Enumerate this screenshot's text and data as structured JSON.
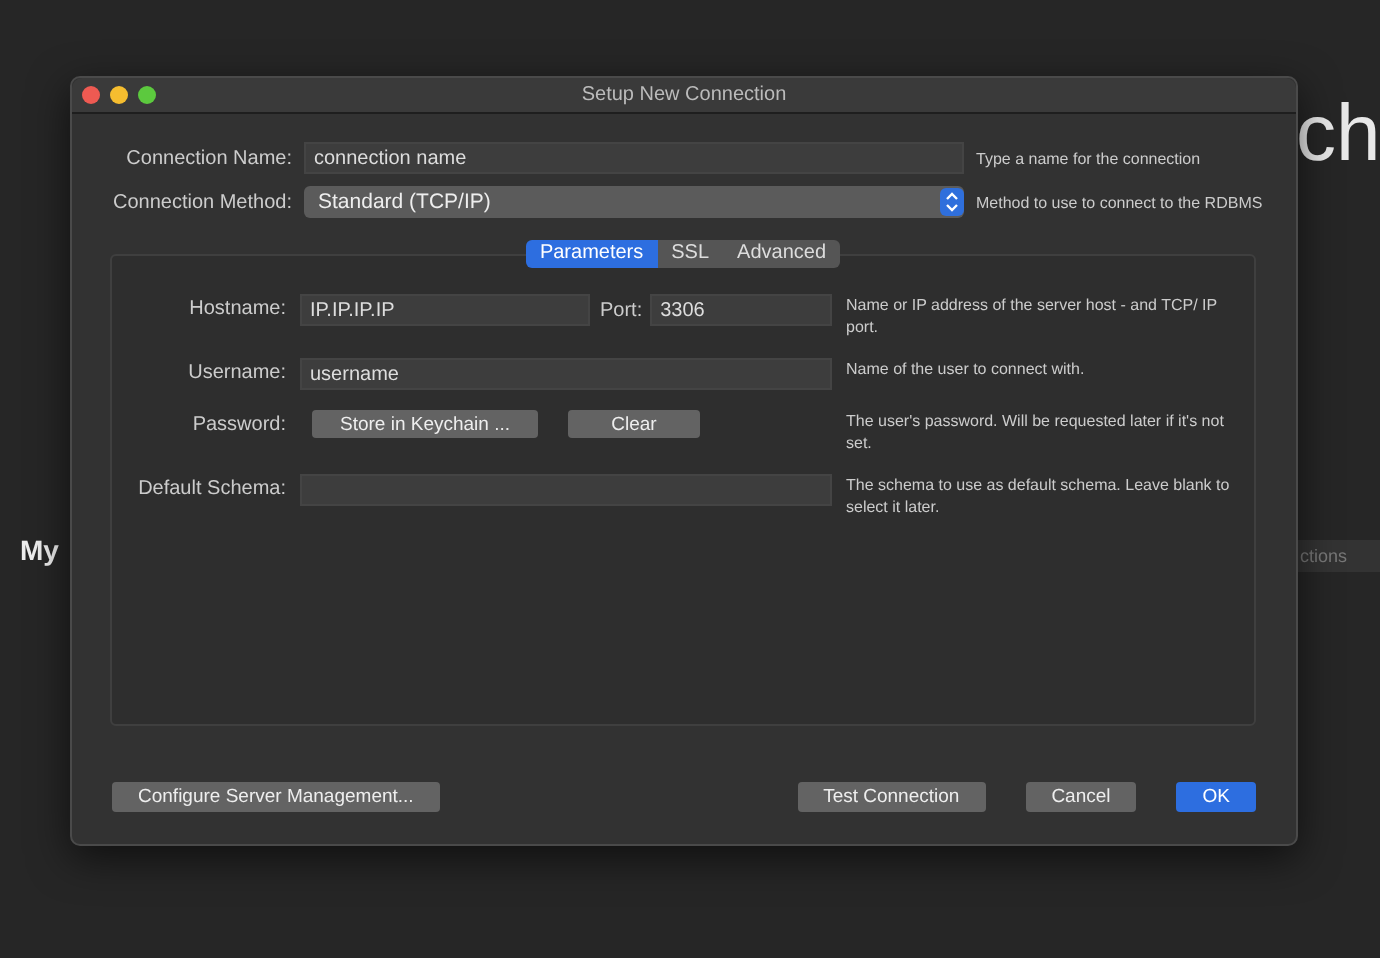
{
  "background": {
    "heading_right": "ch",
    "section_label": "My",
    "search": {
      "placeholder": "ctions"
    }
  },
  "window": {
    "title": "Setup New Connection"
  },
  "connection_name": {
    "label": "Connection Name:",
    "value": "connection name",
    "hint": "Type a name for the connection"
  },
  "connection_method": {
    "label": "Connection Method:",
    "value": "Standard (TCP/IP)",
    "hint": "Method to use to connect to the RDBMS"
  },
  "tabs": [
    {
      "label": "Parameters",
      "selected": true
    },
    {
      "label": "SSL",
      "selected": false
    },
    {
      "label": "Advanced",
      "selected": false
    }
  ],
  "hostname": {
    "label": "Hostname:",
    "value": "IP.IP.IP.IP",
    "port_label": "Port:",
    "port_value": "3306",
    "hint": "Name or IP address of the server host - and TCP/ IP port."
  },
  "username": {
    "label": "Username:",
    "value": "username",
    "hint": "Name of the user to connect with."
  },
  "password": {
    "label": "Password:",
    "buttons": [
      "Store in Keychain ...",
      "Clear"
    ],
    "hint": "The user's password. Will be requested later if it's not set."
  },
  "default_schema": {
    "label": "Default Schema:",
    "hint": "The schema to use as default schema. Leave blank to select it later."
  },
  "footer_buttons": [
    {
      "label": "Configure Server Management...",
      "kind": "normal"
    },
    {
      "label": "Test Connection",
      "kind": "normal"
    },
    {
      "label": "Cancel",
      "kind": "normal"
    },
    {
      "label": "OK",
      "kind": "default"
    }
  ]
}
